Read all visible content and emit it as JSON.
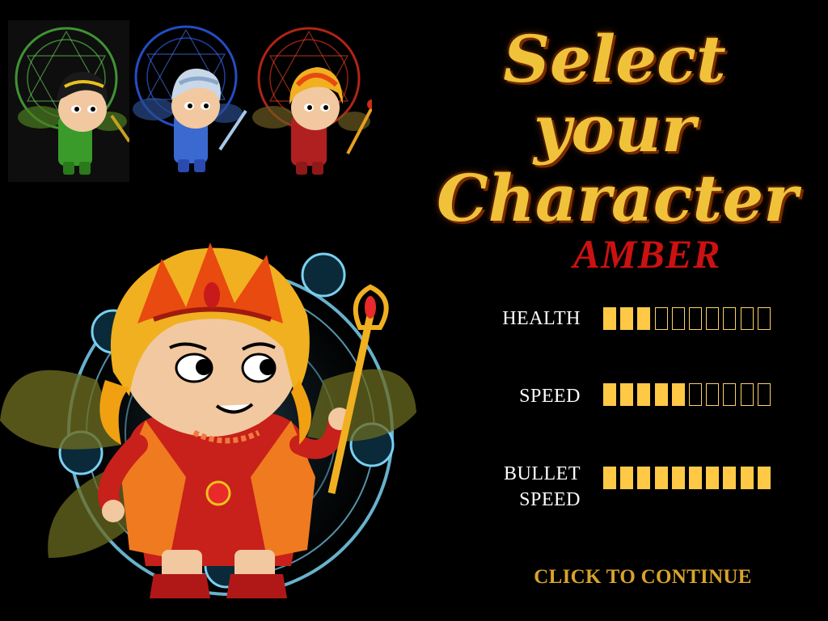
{
  "screen": {
    "title_line1": "Select your",
    "title_line2": "Character"
  },
  "characters": [
    {
      "id": "green",
      "icon": "green-fairy-portrait",
      "color": "#3fa63a"
    },
    {
      "id": "blue",
      "icon": "blue-fairy-portrait",
      "color": "#3a6fd8"
    },
    {
      "id": "red",
      "icon": "red-fairy-portrait",
      "color": "#d83a1e"
    }
  ],
  "selected": {
    "name": "AMBER",
    "name_color": "#cc1111",
    "icon": "amber-fairy-large-portrait"
  },
  "stats": [
    {
      "label_lines": [
        "HEALTH"
      ],
      "value": 3,
      "max": 10
    },
    {
      "label_lines": [
        "SPEED"
      ],
      "value": 5,
      "max": 10
    },
    {
      "label_lines": [
        "BULLET",
        "SPEED"
      ],
      "value": 10,
      "max": 10
    }
  ],
  "stat_bar_color": "#ffc945",
  "continue_label": "CLICK TO CONTINUE"
}
